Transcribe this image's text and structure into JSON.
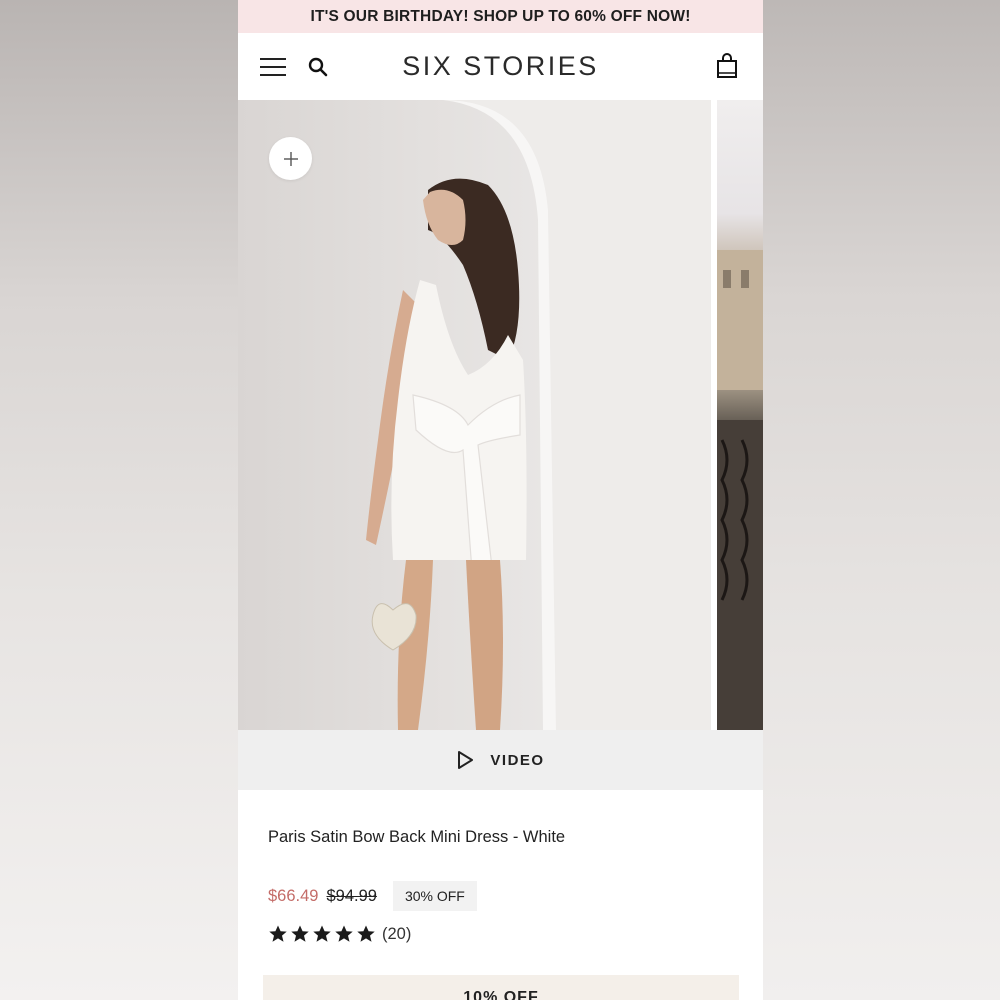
{
  "promo": {
    "text": "IT'S OUR BIRTHDAY! SHOP UP TO 60% OFF NOW!"
  },
  "header": {
    "brand": "SIX STORIES",
    "icons": [
      "menu-icon",
      "search-icon",
      "shopping-bag-icon"
    ]
  },
  "gallery": {
    "add_icon": "plus-icon",
    "video_label": "VIDEO",
    "video_icon": "play-icon"
  },
  "product": {
    "title": "Paris Satin Bow Back Mini Dress - White",
    "sale_price": "$66.49",
    "original_price": "$94.99",
    "discount": "30% OFF",
    "rating": 5,
    "review_count": "(20)"
  },
  "cta": {
    "text": "10% OFF"
  },
  "colors": {
    "promo_bg": "#f8e5e6",
    "sale_price": "#c46c68",
    "video_bar_bg": "#efefef",
    "badge_bg": "#f2f2f2"
  }
}
